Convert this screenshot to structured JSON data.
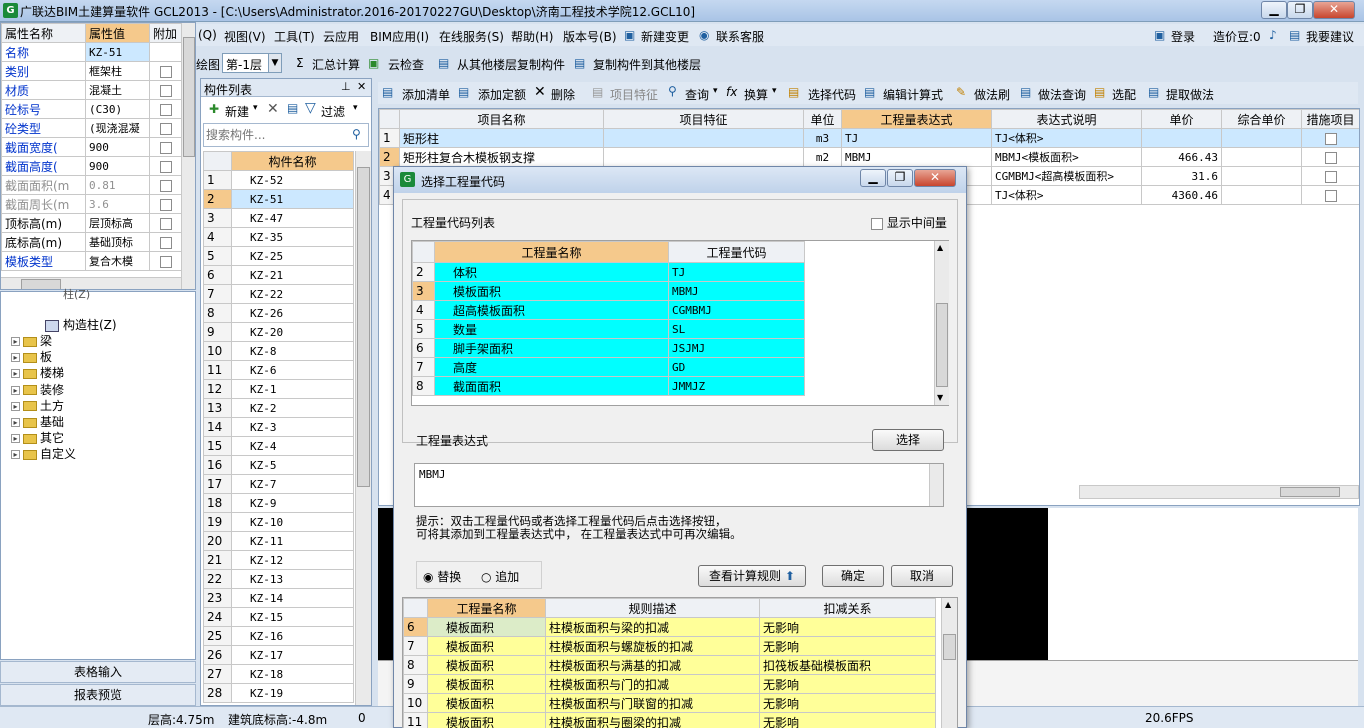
{
  "window": {
    "title": "广联达BIM土建算量软件 GCL2013 - [C:\\Users\\Administrator.2016-20170227GU\\Desktop\\济南工程技术学院12.GCL10]"
  },
  "menu": [
    "(Q)",
    "视图(V)",
    "工具(T)",
    "云应用",
    "BIM应用(I)",
    "在线服务(S)",
    "帮助(H)",
    "版本号(B)",
    "新建变更",
    "联系客服"
  ],
  "menu_right": {
    "login": "登录",
    "cost_beans": "造价豆:0",
    "suggest": "我要建议"
  },
  "toolbar2": {
    "draw": "绘图",
    "floor": "第-1层",
    "summary": "汇总计算",
    "cloud_check": "云检查",
    "copy_from": "从其他楼层复制构件",
    "copy_to": "复制构件到其他楼层"
  },
  "props": {
    "headers": [
      "属性名称",
      "属性值",
      "附加"
    ],
    "rows": [
      {
        "name": "名称",
        "value": "KZ-51",
        "style": "blue"
      },
      {
        "name": "类别",
        "value": "框架柱",
        "style": "blue"
      },
      {
        "name": "材质",
        "value": "混凝土",
        "style": "blue"
      },
      {
        "name": "砼标号",
        "value": "(C30)",
        "style": "blue"
      },
      {
        "name": "砼类型",
        "value": "(现浇混凝",
        "style": "blue"
      },
      {
        "name": "截面宽度(",
        "value": "900",
        "style": "blue"
      },
      {
        "name": "截面高度(",
        "value": "900",
        "style": "blue"
      },
      {
        "name": "截面面积(m",
        "value": "0.81",
        "style": "gray"
      },
      {
        "name": "截面周长(m",
        "value": "3.6",
        "style": "gray"
      },
      {
        "name": "顶标高(m)",
        "value": "层顶标高",
        "style": "normal"
      },
      {
        "name": "底标高(m)",
        "value": "基础顶标",
        "style": "normal"
      },
      {
        "name": "模板类型",
        "value": "复合木模",
        "style": "blue"
      }
    ]
  },
  "tree": {
    "items": [
      {
        "label": "构造柱(Z)",
        "type": "leaf"
      },
      {
        "label": "梁",
        "type": "folder"
      },
      {
        "label": "板",
        "type": "folder"
      },
      {
        "label": "楼梯",
        "type": "folder"
      },
      {
        "label": "装修",
        "type": "folder"
      },
      {
        "label": "土方",
        "type": "folder"
      },
      {
        "label": "基础",
        "type": "folder"
      },
      {
        "label": "其它",
        "type": "folder"
      },
      {
        "label": "自定义",
        "type": "folder"
      }
    ],
    "partial": "柱(Z)"
  },
  "bottom_left": {
    "table_input": "表格输入",
    "report_preview": "报表预览"
  },
  "status": {
    "floor_height": "层高:4.75m",
    "base_height": "建筑底标高:-4.8m",
    "zero": "0",
    "fps": "20.6FPS"
  },
  "comp_list": {
    "title": "构件列表",
    "new_btn": "新建",
    "filter_btn": "过滤",
    "search_placeholder": "搜索构件...",
    "header": "构件名称",
    "rows": [
      "KZ-52",
      "KZ-51",
      "KZ-47",
      "KZ-35",
      "KZ-25",
      "KZ-21",
      "KZ-22",
      "KZ-26",
      "KZ-20",
      "KZ-8",
      "KZ-6",
      "KZ-1",
      "KZ-2",
      "KZ-3",
      "KZ-4",
      "KZ-5",
      "KZ-7",
      "KZ-9",
      "KZ-10",
      "KZ-11",
      "KZ-12",
      "KZ-13",
      "KZ-14",
      "KZ-15",
      "KZ-16",
      "KZ-17",
      "KZ-18",
      "KZ-19"
    ]
  },
  "quota_toolbar": [
    "添加清单",
    "添加定额",
    "删除",
    "项目特征",
    "查询",
    "换算",
    "选择代码",
    "编辑计算式",
    "做法刷",
    "做法查询",
    "选配",
    "提取做法"
  ],
  "quota_table": {
    "headers": [
      "项目名称",
      "项目特征",
      "单位",
      "工程量表达式",
      "表达式说明",
      "单价",
      "综合单价",
      "措施项目"
    ],
    "rows": [
      {
        "name": "矩形柱",
        "unit": "m3",
        "expr": "TJ",
        "desc": "TJ<体积>",
        "price": ""
      },
      {
        "name": "矩形柱复合木模板钢支撑",
        "unit": "m2",
        "expr": "MBMJ",
        "desc": "MBMJ<模板面积>",
        "price": "466.43"
      },
      {
        "name": "",
        "unit": "",
        "expr": "",
        "desc": "CGMBMJ<超高模板面积>",
        "price": "31.6"
      },
      {
        "name": "",
        "unit": "",
        "expr": "",
        "desc": "TJ<体积>",
        "price": "4360.46"
      }
    ]
  },
  "dialog": {
    "title": "选择工程量代码",
    "list_label": "工程量代码列表",
    "show_middle": "显示中间量",
    "headers": [
      "工程量名称",
      "工程量代码"
    ],
    "rows": [
      {
        "no": "2",
        "name": "体积",
        "code": "TJ"
      },
      {
        "no": "3",
        "name": "模板面积",
        "code": "MBMJ"
      },
      {
        "no": "4",
        "name": "超高模板面积",
        "code": "CGMBMJ"
      },
      {
        "no": "5",
        "name": "数量",
        "code": "SL"
      },
      {
        "no": "6",
        "name": "脚手架面积",
        "code": "JSJMJ"
      },
      {
        "no": "7",
        "name": "高度",
        "code": "GD"
      },
      {
        "no": "8",
        "name": "截面面积",
        "code": "JMMJZ"
      }
    ],
    "expr_label": "工程量表达式",
    "select_btn": "选择",
    "expr_value": "MBMJ",
    "hint1": "提示：双击工程量代码或者选择工程量代码后点击选择按钮，",
    "hint2": "可将其添加到工程量表达式中， 在工程量表达式中可再次编辑。",
    "replace": "替换",
    "append": "追加",
    "view_rules": "查看计算规则",
    "ok": "确定",
    "cancel": "取消",
    "rules_headers": [
      "工程量名称",
      "规则描述",
      "扣减关系"
    ],
    "rules": [
      {
        "no": "6",
        "name": "模板面积",
        "desc": "柱模板面积与梁的扣减",
        "rel": "无影响"
      },
      {
        "no": "7",
        "name": "模板面积",
        "desc": "柱模板面积与螺旋板的扣减",
        "rel": "无影响"
      },
      {
        "no": "8",
        "name": "模板面积",
        "desc": "柱模板面积与满基的扣减",
        "rel": "扣筏板基础模板面积"
      },
      {
        "no": "9",
        "name": "模板面积",
        "desc": "柱模板面积与门的扣减",
        "rel": "无影响"
      },
      {
        "no": "10",
        "name": "模板面积",
        "desc": "柱模板面积与门联窗的扣减",
        "rel": "无影响"
      },
      {
        "no": "11",
        "name": "模板面积",
        "desc": "柱模板面积与圈梁的扣减",
        "rel": "无影响"
      }
    ]
  },
  "colors": {
    "accent_orange": "#f5c98c",
    "cyan": "#00ffff",
    "yellow": "#ffff99",
    "selected_blue": "#cce8ff"
  }
}
